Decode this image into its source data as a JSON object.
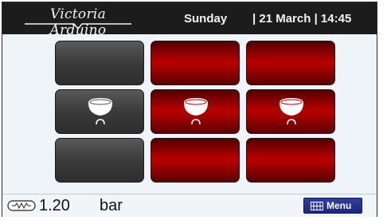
{
  "header": {
    "brand": "Victoria Arduino",
    "day": "Sunday",
    "datetime": "| 21 March | 14:45"
  },
  "groups": [
    {
      "row": "top",
      "column": 1,
      "state": "off",
      "icon": null
    },
    {
      "row": "top",
      "column": 2,
      "state": "on",
      "icon": null
    },
    {
      "row": "top",
      "column": 3,
      "state": "on",
      "icon": null
    },
    {
      "row": "middle",
      "column": 1,
      "state": "off",
      "icon": "cup-icon"
    },
    {
      "row": "middle",
      "column": 2,
      "state": "on",
      "icon": "cup-icon"
    },
    {
      "row": "middle",
      "column": 3,
      "state": "on",
      "icon": "cup-icon"
    },
    {
      "row": "bottom",
      "column": 1,
      "state": "off",
      "icon": null
    },
    {
      "row": "bottom",
      "column": 2,
      "state": "on",
      "icon": null
    },
    {
      "row": "bottom",
      "column": 3,
      "state": "on",
      "icon": null
    }
  ],
  "footer": {
    "pressure_icon": "pressure-gauge-icon",
    "pressure_value": "1.20",
    "pressure_unit": "bar",
    "menu_icon": "grid-icon",
    "menu_label": "Menu"
  },
  "colors": {
    "header_bg": "#1c1c1c",
    "tile_on": "#b50000",
    "tile_off": "#3a3a3a",
    "menu_button": "#1b2680"
  }
}
